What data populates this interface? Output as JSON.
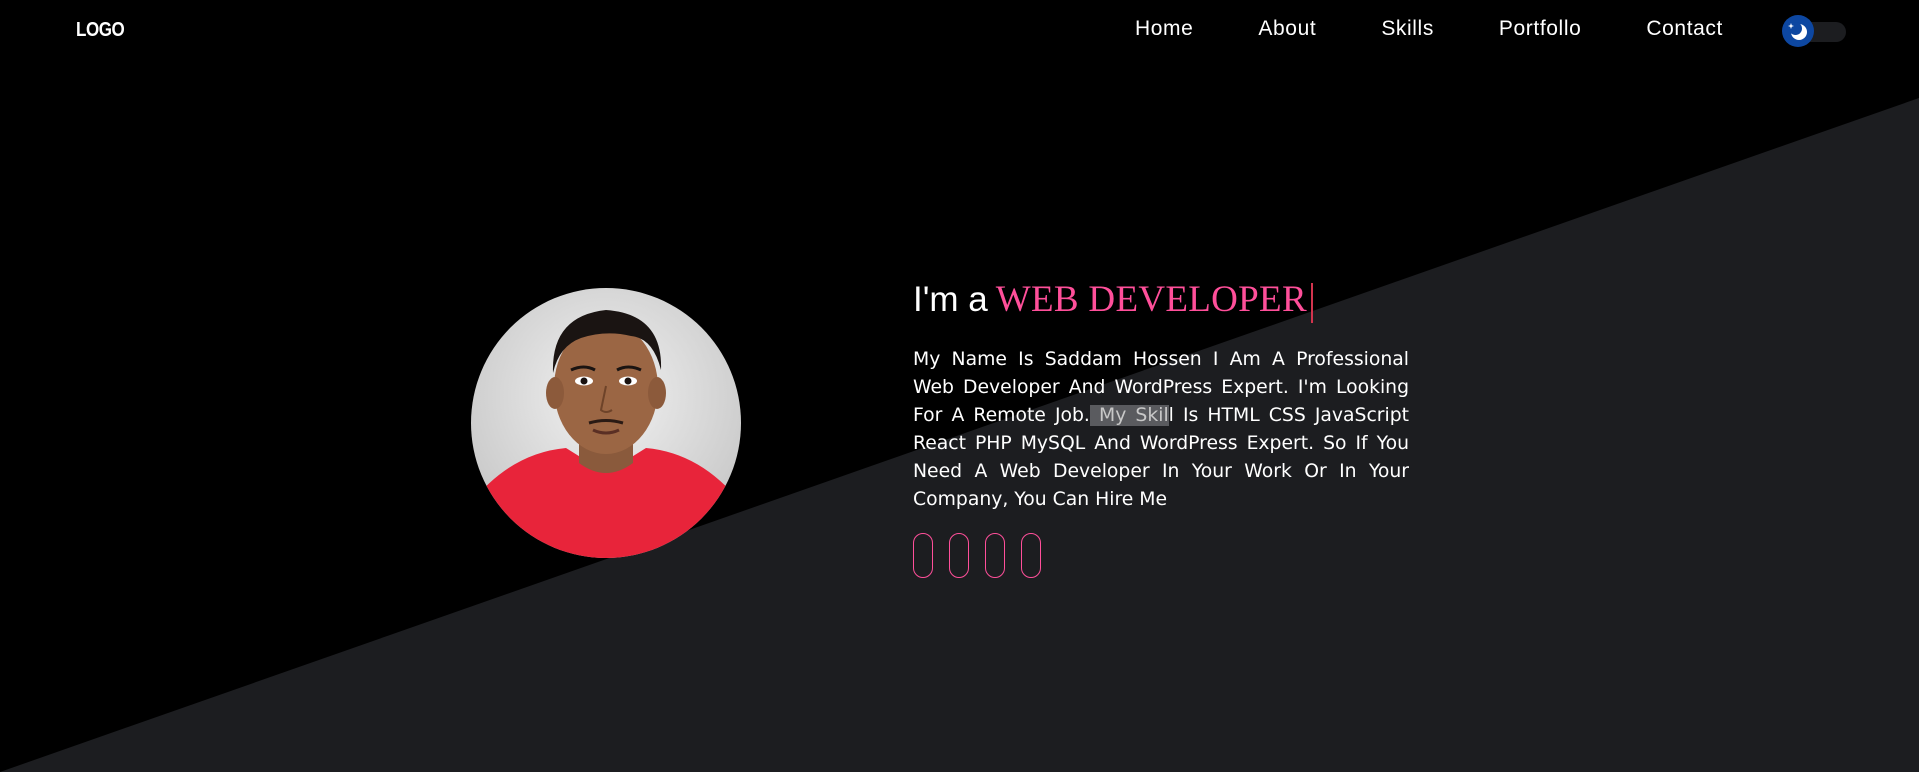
{
  "header": {
    "logo": "LOGO",
    "nav": [
      {
        "label": "Home"
      },
      {
        "label": "About"
      },
      {
        "label": "Skills"
      },
      {
        "label": "Portfollo"
      },
      {
        "label": "Contact"
      }
    ],
    "theme_toggle": {
      "icon": "moon-icon",
      "state": "dark"
    }
  },
  "hero": {
    "headline_prefix": "I'm a",
    "headline_role": "WEB DEVELOPER",
    "bio_part1": "My Name Is Saddam Hossen I Am A Professional Web Developer And WordPress Expert. I'm Looking For A Remote Job.",
    "bio_selected": " My Skil",
    "bio_part2": "l Is HTML CSS JavaScript React PHP MySQL And WordPress Expert. So If You Need A Web Developer In Your Work Or In Your Company, You Can Hire Me",
    "socials": [
      {
        "icon": "social-icon-1"
      },
      {
        "icon": "social-icon-2"
      },
      {
        "icon": "social-icon-3"
      },
      {
        "icon": "social-icon-4"
      }
    ]
  },
  "colors": {
    "background": "#000000",
    "diagonal_panel": "#1c1d20",
    "accent": "#ff4f9a",
    "cursor": "#d3344e",
    "toggle_knob": "#0d47a1"
  }
}
